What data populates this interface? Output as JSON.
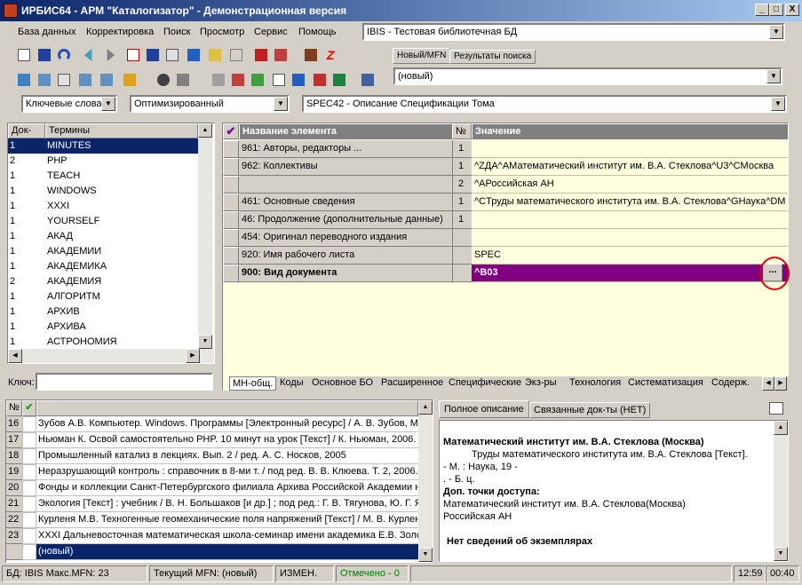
{
  "window": {
    "title": "ИРБИС64 - АРМ \"Каталогизатор\" - Демонстрационная версия",
    "min": "_",
    "max": "□",
    "close": "X"
  },
  "menu": [
    "База данных",
    "Корректировка",
    "Поиск",
    "Просмотр",
    "Сервис",
    "Помощь"
  ],
  "db_select": "IBIS - Тестовая библиотечная БД",
  "top_tabs": [
    "Новый/MFN",
    "Результаты поиска"
  ],
  "new_combo": "(новый)",
  "search_mode": "Ключевые слова",
  "search_opt": "Оптимизированный",
  "worksheet": "SPEC42 - Описание Спецификации Тома",
  "dict": {
    "col_docs": "Док-ов",
    "col_terms": "Термины",
    "key_label": "Ключ:",
    "rows": [
      [
        "1",
        "MINUTES"
      ],
      [
        "2",
        "PHP"
      ],
      [
        "1",
        "TEACH"
      ],
      [
        "1",
        "WINDOWS"
      ],
      [
        "1",
        "XXXI"
      ],
      [
        "1",
        "YOURSELF"
      ],
      [
        "1",
        "АКАД"
      ],
      [
        "1",
        "АКАДЕМИИ"
      ],
      [
        "1",
        "АКАДЕМИКА"
      ],
      [
        "2",
        "АКАДЕМИЯ"
      ],
      [
        "1",
        "АЛГОРИТМ"
      ],
      [
        "1",
        "АРХИВ"
      ],
      [
        "1",
        "АРХИВА"
      ],
      [
        "1",
        "АСТРОНОМИЯ"
      ]
    ]
  },
  "editor": {
    "col_name": "Название элемента",
    "col_no": "№",
    "col_value": "Значение",
    "rows": [
      [
        "961: Авторы, редакторы ...",
        "1",
        ""
      ],
      [
        "962: Коллективы",
        "1",
        "^ZДА^AМатематический институт им. В.А. Стеклова^U3^CМосква"
      ],
      [
        "",
        "2",
        "^AРоссийская АН"
      ],
      [
        "461: Основные сведения",
        "1",
        "^CТруды математического института им. В.А. Стеклова^GНаука^DМ"
      ],
      [
        "46: Продолжение (дополнительные данные)",
        "1",
        ""
      ],
      [
        "454: Оригинал переводного издания",
        "",
        ""
      ],
      [
        "920: Имя рабочего листа",
        "",
        "SPEC"
      ],
      [
        "900: Вид документа",
        "",
        "^B03"
      ]
    ],
    "ellipsis": "...",
    "tabs": [
      "МН-общ.",
      "Коды",
      "Основное БО",
      "Расширенное",
      "Специфические",
      "Экз-ры",
      "Технология",
      "Систематизация",
      "Содерж."
    ]
  },
  "records": {
    "col_no": "№",
    "rows": [
      [
        "16",
        "Зубов А.В. Компьютер. Windows. Программы [Электронный ресурс] / А. В. Зубов, М"
      ],
      [
        "17",
        "Ньюман К. Освой самостоятельно PHP. 10 минут на урок [Текст] / К. Ньюман, 2006."
      ],
      [
        "18",
        "Промышленный катализ в лекциях. Вып. 2 / ред. А. С. Носков, 2005"
      ],
      [
        "19",
        "Неразрушающий контроль : справочник в 8-ми т. / под ред. В. В. Клюева. Т. 2, 2006."
      ],
      [
        "20",
        "Фонды и коллекции Санкт-Петербургского филиала Архива Российской Академии н"
      ],
      [
        "21",
        "Экология [Текст] : учебник / В. Н. Большаков [и др.] ; под ред.: Г. В. Тягунова, Ю. Г. Я"
      ],
      [
        "22",
        "Курленя М.В. Техногенные геомеханические поля напряжений [Текст] / М. В. Курлен"
      ],
      [
        "23",
        "XXXI Дальневосточная математическая школа-семинар имени академика Е.В. Золо"
      ],
      [
        "",
        "(новый)"
      ]
    ]
  },
  "preview": {
    "tabs": [
      "Полное описание",
      "Связанные док-ты (НЕТ)"
    ],
    "lines": [
      "Математический институт им. В.А. Стеклова (Москва)",
      "Труды математического института им. В.А. Стеклова [Текст].",
      "- М. : Наука, 19 -",
      ". - Б. ц.",
      "Доп. точки доступа:",
      "Математический институт им. В.А. Стеклова(Москва)",
      "Российская АН",
      "Нет сведений об экземплярах"
    ]
  },
  "status": {
    "db": "БД: IBIS Макс.MFN: 23",
    "mfn": "Текущий MFN: (новый)",
    "changed": "ИЗМЕН.",
    "marked": "Отмечено - 0",
    "time": "12:59",
    "time2": "00:40"
  }
}
